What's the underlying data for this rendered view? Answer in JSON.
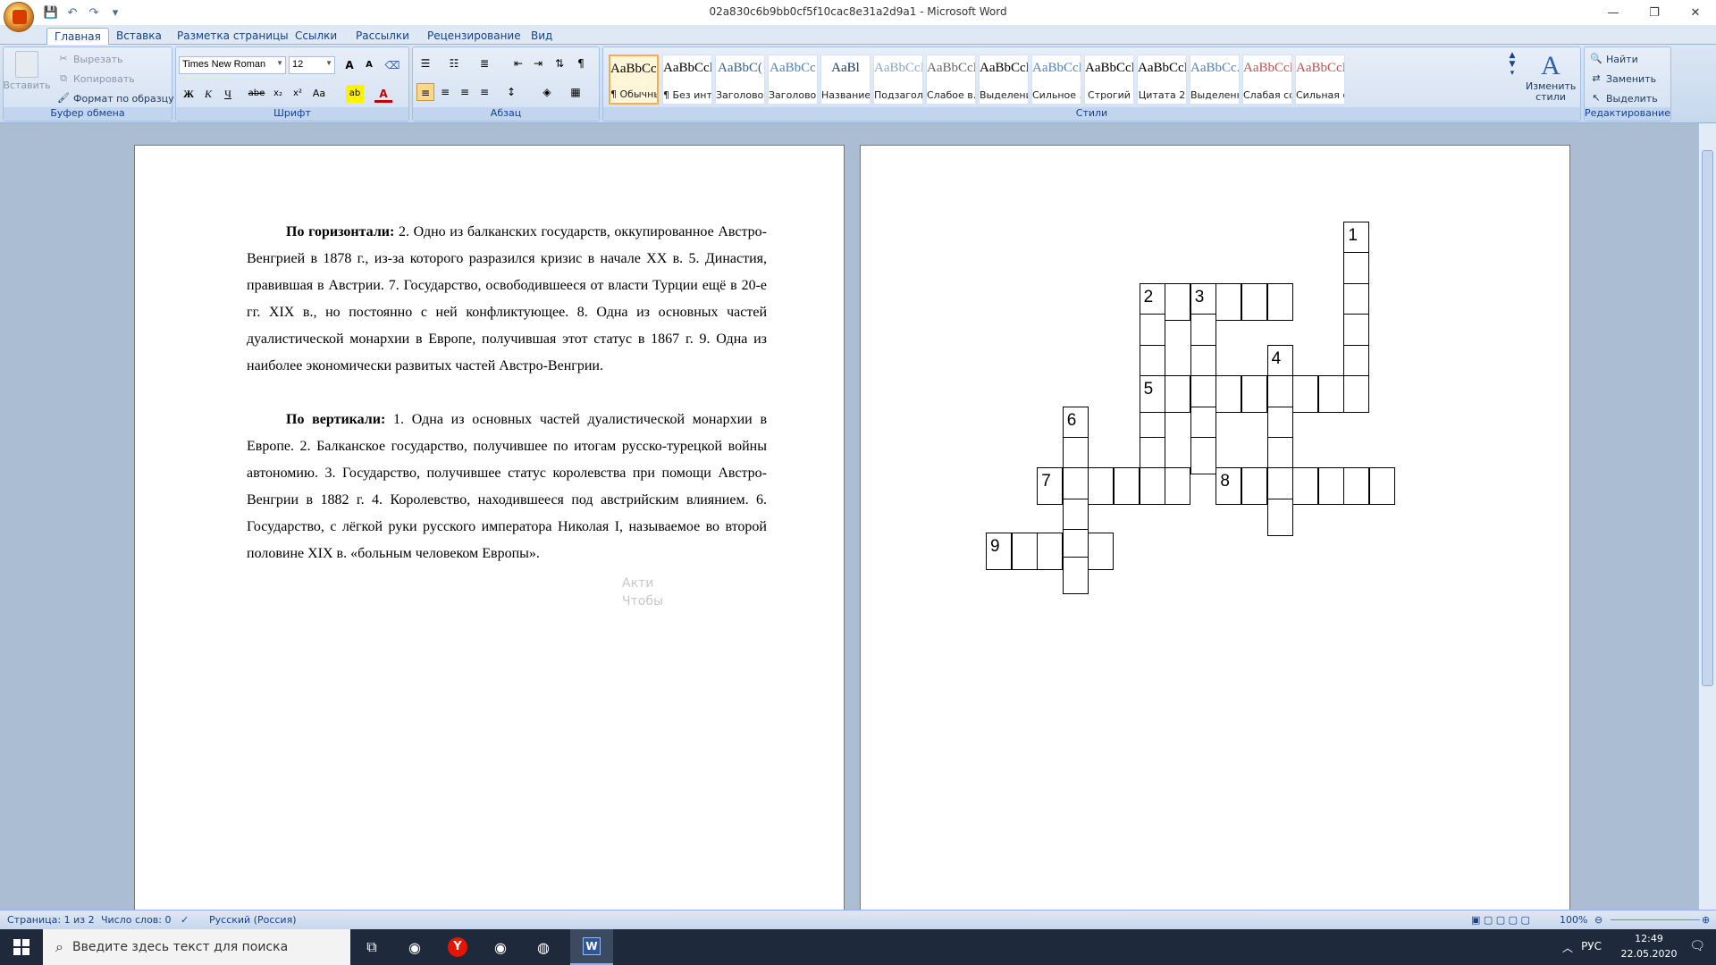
{
  "window": {
    "title": "02a830c6b9bb0cf5f10cac8e31a2d9a1 - Microsoft Word",
    "controls": [
      "—",
      "❐",
      "✕"
    ]
  },
  "qat": [
    "💾",
    "↶",
    "↷",
    "▾"
  ],
  "tabs": [
    "Главная",
    "Вставка",
    "Разметка страницы",
    "Ссылки",
    "Рассылки",
    "Рецензирование",
    "Вид"
  ],
  "ribbon": {
    "clipboard": {
      "label": "Буфер обмена",
      "paste": "Вставить",
      "cut": "Вырезать",
      "copy": "Копировать",
      "format_painter": "Формат по образцу"
    },
    "font": {
      "label": "Шрифт",
      "font_name": "Times New Roman",
      "font_size": "12"
    },
    "paragraph": {
      "label": "Абзац"
    },
    "styles": {
      "label": "Стили",
      "items": [
        {
          "sample": "AaBbCcI",
          "name": "¶ Обычный",
          "color": "#000000"
        },
        {
          "sample": "AaBbCcI",
          "name": "¶ Без инте...",
          "color": "#000000"
        },
        {
          "sample": "AaBbC(",
          "name": "Заголово...",
          "color": "#365f91"
        },
        {
          "sample": "AaBbCc",
          "name": "Заголово...",
          "color": "#4f81bd"
        },
        {
          "sample": "AaBl",
          "name": "Название",
          "color": "#17365d"
        },
        {
          "sample": "AaBbCcI",
          "name": "Подзагол...",
          "color": "#8aa6c8"
        },
        {
          "sample": "AaBbCcD",
          "name": "Слабое в...",
          "color": "#666666"
        },
        {
          "sample": "AaBbCcD",
          "name": "Выделение",
          "color": "#000000"
        },
        {
          "sample": "AaBbCcD",
          "name": "Сильное ...",
          "color": "#4f81bd"
        },
        {
          "sample": "AaBbCcD",
          "name": "Строгий",
          "color": "#000000"
        },
        {
          "sample": "AaBbCcI",
          "name": "Цитата 2",
          "color": "#000000"
        },
        {
          "sample": "AaBbCc.",
          "name": "Выделенн...",
          "color": "#4f81bd"
        },
        {
          "sample": "AaBbCcD",
          "name": "Слабая сс...",
          "color": "#c0504d"
        },
        {
          "sample": "AaBbCcD",
          "name": "Сильная с...",
          "color": "#c0504d"
        }
      ],
      "change_styles": "Изменить стили"
    },
    "editing": {
      "label": "Редактирование",
      "find": "Найти",
      "replace": "Заменить",
      "select": "Выделить"
    }
  },
  "document": {
    "horizontal_heading": "По горизонтали:",
    "horizontal_text": " 2. Одно из балканских государств, оккупированное Австро-Венгрией в 1878 г., из-за которого разразился кризис в начале XX в. 5. Династия, правившая в Австрии. 7. Государство, освободившееся от власти Турции ещё в 20-е гг. XIX в., но постоянно с ней конфликтующее. 8. Одна из основных частей дуалистической монархии в Европе, получившая этот статус в 1867 г. 9. Одна из наиболее экономически развитых частей Австро-Венгрии.",
    "vertical_heading": "По вертикали:",
    "vertical_text": " 1. Одна из основных частей дуалистической монархии в Европе. 2. Балканское государство, получившее по итогам русско-турецкой войны автономию. 3. Государство, получившее статус королевства при помощи Австро-Венгрии в 1882 г. 4. Королевство, находившееся под австрийским влиянием. 6. Государство, с лёгкой руки русского императора Николая I, называемое во второй половине XIX в. «больным человеком Европы».",
    "ghost_text": [
      "Акти",
      "Чтобы"
    ]
  },
  "crossword_numbers": [
    "1",
    "2",
    "3",
    "4",
    "5",
    "6",
    "7",
    "8",
    "9"
  ],
  "statusbar": {
    "page": "Страница: 1 из 2",
    "words": "Число слов: 0",
    "language": "Русский (Россия)",
    "zoom": "100%"
  },
  "taskbar": {
    "search_placeholder": "Введите здесь текст для поиска",
    "lang": "РУС",
    "time": "12:49",
    "date": "22.05.2020"
  }
}
